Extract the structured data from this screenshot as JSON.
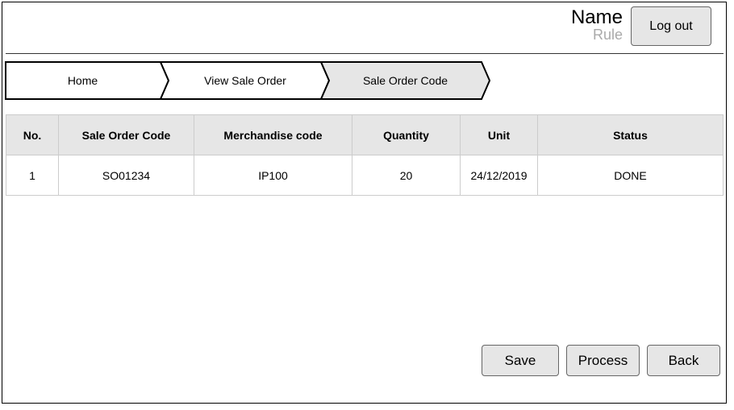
{
  "header": {
    "user_name": "Name",
    "user_role": "Rule",
    "logout_label": "Log out"
  },
  "breadcrumb": [
    {
      "label": "Home",
      "active": false
    },
    {
      "label": "View Sale Order",
      "active": false
    },
    {
      "label": "Sale Order Code",
      "active": true
    }
  ],
  "table": {
    "headers": [
      "No.",
      "Sale Order Code",
      "Merchandise code",
      "Quantity",
      "Unit",
      "Status"
    ],
    "rows": [
      [
        "1",
        "SO01234",
        "IP100",
        "20",
        "24/12/2019",
        "DONE"
      ]
    ]
  },
  "actions": {
    "save_label": "Save",
    "process_label": "Process",
    "back_label": "Back"
  },
  "colors": {
    "button_bg": "#e6e6e6",
    "active_crumb_bg": "#e6e6e6",
    "role_text": "#aaaaaa"
  }
}
